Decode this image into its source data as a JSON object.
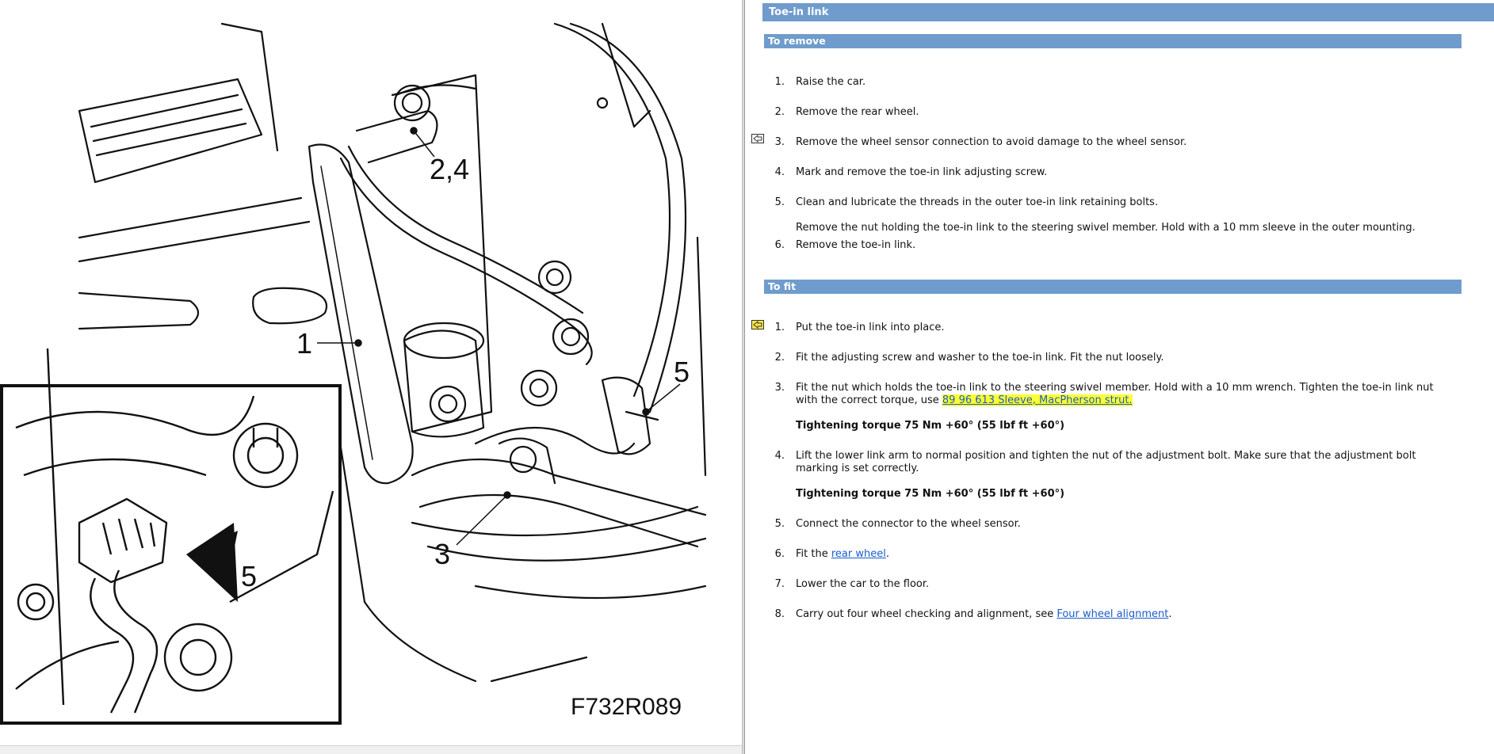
{
  "diagram": {
    "figure_code": "F732R089",
    "callouts": [
      "1",
      "2,4",
      "3",
      "5",
      "5"
    ]
  },
  "doc": {
    "title": "Toe-in link",
    "remove": {
      "heading": "To remove",
      "steps": [
        {
          "num": "1.",
          "text": "Raise the car."
        },
        {
          "num": "2.",
          "text": "Remove the rear wheel."
        },
        {
          "num": "3.",
          "text": "Remove the wheel sensor connection to avoid damage to the wheel sensor."
        },
        {
          "num": "4.",
          "text": "Mark and remove the toe-in link adjusting screw."
        },
        {
          "num": "5.",
          "text": "Clean and lubricate the threads in the outer toe-in link retaining bolts."
        },
        {
          "num": "",
          "text": "Remove the nut holding the toe-in link to the steering swivel member. Hold with a 10 mm sleeve in the outer mounting."
        },
        {
          "num": "6.",
          "text": "Remove the toe-in link."
        }
      ]
    },
    "fit": {
      "heading": "To fit",
      "step1": {
        "num": "1.",
        "text": "Put the toe-in link into place."
      },
      "step2": {
        "num": "2.",
        "text": "Fit the adjusting screw and washer to the toe-in link. Fit the nut loosely."
      },
      "step3": {
        "num": "3.",
        "text_a": "Fit the nut which holds the toe-in link to the steering swivel member. Hold with a 10 mm wrench. Tighten the toe-in link nut",
        "text_b": "with the correct torque, use ",
        "link": "89 96 613 Sleeve, MacPherson strut.",
        "torque": "Tightening torque 75 Nm +60° (55 lbf ft +60°)"
      },
      "step4": {
        "num": "4.",
        "text_a": "Lift the lower link arm to normal position and tighten the nut of the adjustment bolt. Make sure that the adjustment bolt",
        "text_b": "marking is set correctly.",
        "torque": "Tightening torque 75 Nm +60° (55 lbf ft +60°)"
      },
      "step5": {
        "num": "5.",
        "text": "Connect the connector to the wheel sensor."
      },
      "step6": {
        "num": "6.",
        "text_a": "Fit the ",
        "link": "rear wheel",
        "text_b": "."
      },
      "step7": {
        "num": "7.",
        "text": "Lower the car to the floor."
      },
      "step8": {
        "num": "8.",
        "text_a": "Carry out four wheel checking and alignment, see ",
        "link": "Four wheel alignment",
        "text_b": "."
      }
    }
  },
  "colors": {
    "section_bar": "#6f9ccc",
    "link": "#1a5ccc",
    "highlight": "#ffff33"
  },
  "icons": [
    "warning-tool-icon",
    "special-tool-icon"
  ]
}
